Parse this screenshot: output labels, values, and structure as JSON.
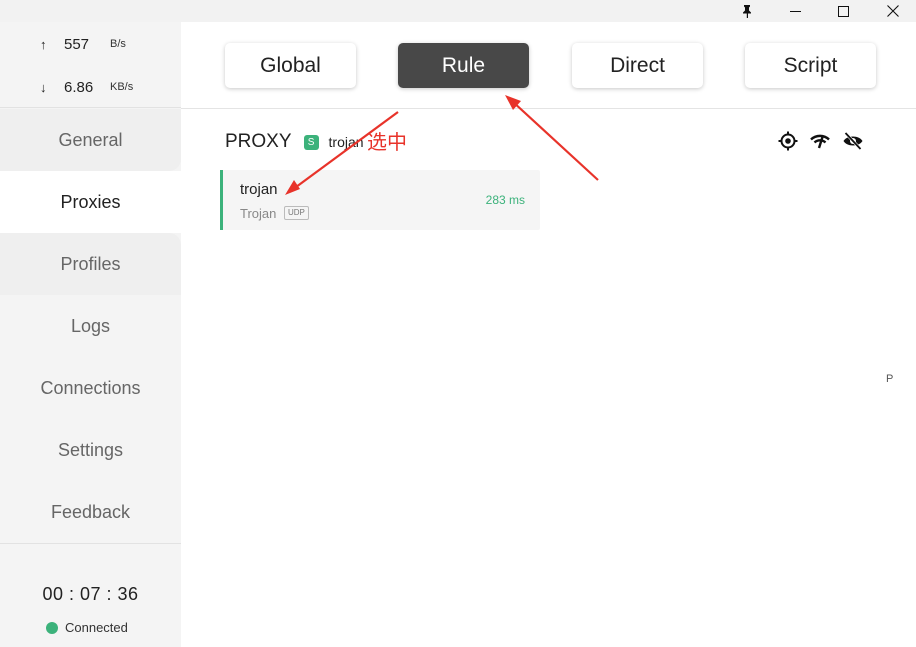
{
  "titlebar": {
    "icons": [
      "pin-icon",
      "minimize-icon",
      "maximize-icon",
      "close-icon"
    ]
  },
  "traffic": {
    "up_arrow": "↑",
    "up_value": "557",
    "up_unit": "B/s",
    "down_arrow": "↓",
    "down_value": "6.86",
    "down_unit": "KB/s"
  },
  "sidebar": {
    "items": [
      {
        "label": "General"
      },
      {
        "label": "Proxies"
      },
      {
        "label": "Profiles"
      },
      {
        "label": "Logs"
      },
      {
        "label": "Connections"
      },
      {
        "label": "Settings"
      },
      {
        "label": "Feedback"
      }
    ],
    "active": "Proxies"
  },
  "status": {
    "timer": "00 : 07 : 36",
    "connection": "Connected",
    "connection_color": "#3cb27b"
  },
  "modes": {
    "items": [
      {
        "label": "Global"
      },
      {
        "label": "Rule"
      },
      {
        "label": "Direct"
      },
      {
        "label": "Script"
      }
    ],
    "selected": "Rule"
  },
  "group": {
    "name": "PROXY",
    "badge": "S",
    "selected": "trojan",
    "annotation": "选中",
    "icons": [
      "locate-icon",
      "speed-test-icon",
      "hide-icon"
    ]
  },
  "proxies": [
    {
      "name": "trojan",
      "type": "Trojan",
      "tag": "UDP",
      "delay": "283 ms"
    }
  ],
  "stray_text": "P",
  "colors": {
    "accent_green": "#3cb27b",
    "active_mode_bg": "#484848",
    "annotation_red": "#e8332a"
  }
}
